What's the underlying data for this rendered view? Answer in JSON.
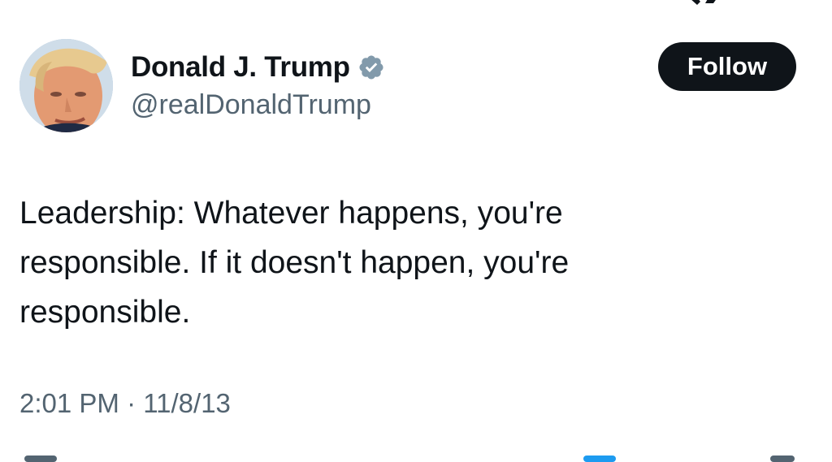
{
  "tweet": {
    "author": {
      "display_name": "Donald J. Trump",
      "handle": "@realDonaldTrump",
      "verified": true,
      "avatar_icon": "profile-photo"
    },
    "follow_label": "Follow",
    "text": "Leadership: Whatever happens, you're\nresponsible. If it doesn't happen, you're\nresponsible.",
    "time": "2:01 PM",
    "separator": "·",
    "date": "11/8/13"
  },
  "icons": {
    "top_right": "x-logo-icon",
    "verified": "verified-badge-icon"
  },
  "colors": {
    "text_primary": "#0f1419",
    "text_secondary": "#536471",
    "follow_bg": "#0f1419",
    "follow_text": "#ffffff",
    "verified": "#829aab"
  }
}
